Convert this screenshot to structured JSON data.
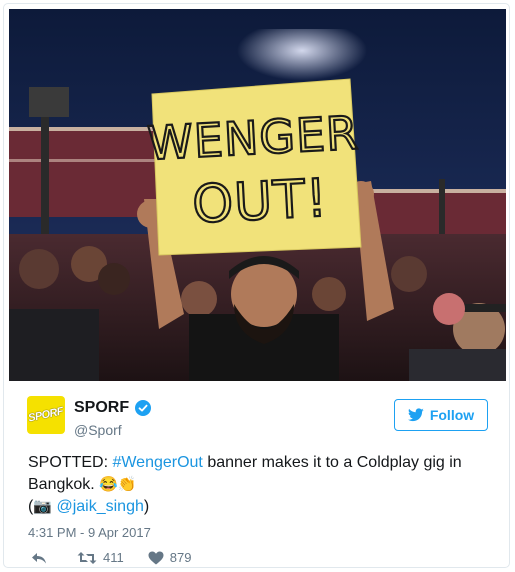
{
  "photo": {
    "sign_line1": "WENGER",
    "sign_line2": "OUT!"
  },
  "account": {
    "avatar_text": "SPORF",
    "name": "SPORF",
    "handle": "@Sporf",
    "verified": true
  },
  "follow_label": "Follow",
  "tweet": {
    "prefix": "SPOTTED: ",
    "hashtag": "#WengerOut",
    "body": " banner makes it to a Coldplay gig in Bangkok. ",
    "emoji1": "😂",
    "emoji2": "👏",
    "credit_open": "(",
    "camera_emoji": "📷",
    "credit_handle": "@jaik_singh",
    "credit_close": ")"
  },
  "timestamp": "4:31 PM - 9 Apr 2017",
  "stats": {
    "retweets": "411",
    "likes": "879"
  },
  "colors": {
    "accent": "#1da1f2",
    "link": "#1b95e0",
    "avatar_bg": "#f5e100"
  }
}
